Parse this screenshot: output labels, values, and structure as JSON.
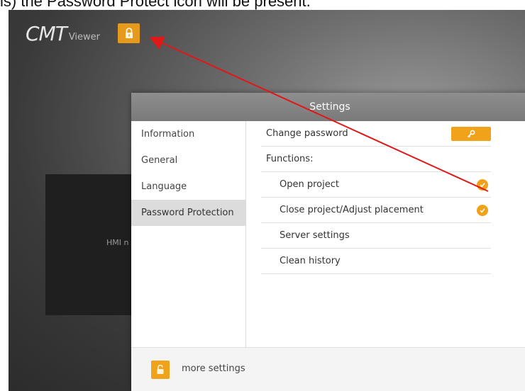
{
  "caption": "is) the Password Protect icon will be present.",
  "brand": {
    "main": "CMT",
    "sub": "Viewer"
  },
  "hmi_label": "HMI n",
  "dialog": {
    "title": "Settings",
    "nav": [
      {
        "label": "Information"
      },
      {
        "label": "General"
      },
      {
        "label": "Language"
      },
      {
        "label": "Password Protection"
      }
    ],
    "rows": {
      "change_password": "Change password",
      "functions": "Functions:",
      "open_project": "Open project",
      "close_project": "Close project/Adjust placement",
      "server_settings": "Server settings",
      "clean_history": "Clean history"
    },
    "footer": {
      "label": "more settings"
    }
  },
  "icons": {
    "lock": "lock-icon",
    "key": "key-icon",
    "check": "check-icon",
    "unlock": "unlock-icon"
  },
  "colors": {
    "accent": "#f0a21a",
    "arrow": "#e01818",
    "title_bar": "#868686",
    "active_nav": "#dcdcdc"
  }
}
